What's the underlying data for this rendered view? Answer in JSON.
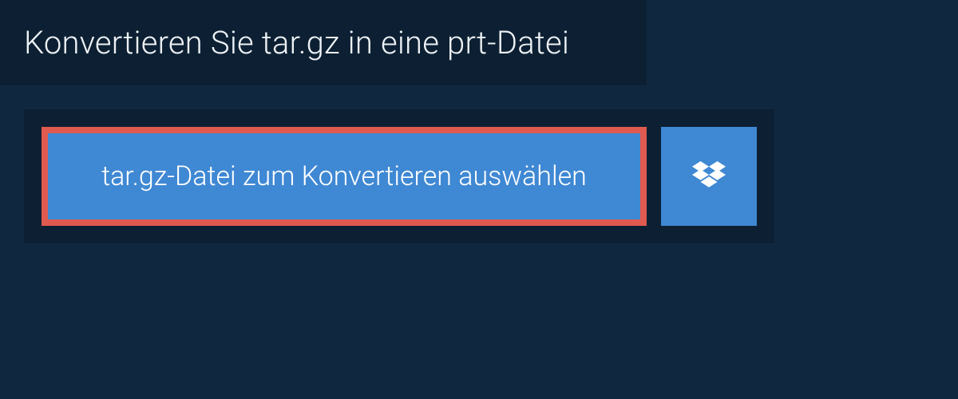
{
  "header": {
    "title": "Konvertieren Sie tar.gz in eine prt-Datei"
  },
  "actions": {
    "select_file_label": "tar.gz-Datei zum Konvertieren auswählen",
    "dropbox_icon": "dropbox-icon"
  },
  "colors": {
    "page_bg": "#10283f",
    "panel_bg": "#0d2033",
    "button_bg": "#3f88d3",
    "highlight_border": "#e05a4f",
    "text": "#ffffff"
  }
}
